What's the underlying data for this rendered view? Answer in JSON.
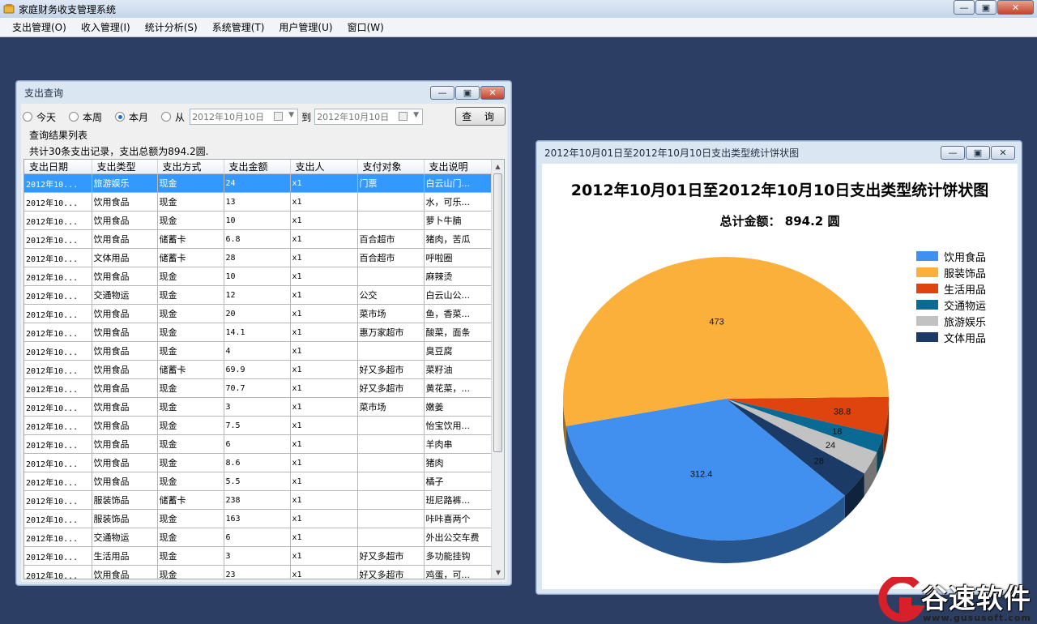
{
  "app": {
    "title": "家庭财务收支管理系统"
  },
  "menu": [
    "支出管理(O)",
    "收入管理(I)",
    "统计分析(S)",
    "系统管理(T)",
    "用户管理(U)",
    "窗口(W)"
  ],
  "query_window": {
    "title": "支出查询",
    "radios": [
      {
        "label": "今天",
        "checked": false
      },
      {
        "label": "本周",
        "checked": false
      },
      {
        "label": "本月",
        "checked": true
      },
      {
        "label": "从",
        "checked": false
      }
    ],
    "date_from": "2012年10月10日",
    "to_label": "到",
    "date_to": "2012年10月10日",
    "query_button": "查 询",
    "group_label": "查询结果列表",
    "summary": "共计30条支出记录，支出总额为894.2圆.",
    "columns": [
      "支出日期",
      "支出类型",
      "支出方式",
      "支出金额",
      "支出人",
      "支付对象",
      "支出说明"
    ],
    "rows": [
      [
        "2012年10...",
        "旅游娱乐",
        "现金",
        "24",
        "x1",
        "门票",
        "白云山门..."
      ],
      [
        "2012年10...",
        "饮用食品",
        "现金",
        "13",
        "x1",
        "",
        "水，可乐..."
      ],
      [
        "2012年10...",
        "饮用食品",
        "现金",
        "10",
        "x1",
        "",
        "萝卜牛腩"
      ],
      [
        "2012年10...",
        "饮用食品",
        "储蓄卡",
        "6.8",
        "x1",
        "百合超市",
        "猪肉，苦瓜"
      ],
      [
        "2012年10...",
        "文体用品",
        "储蓄卡",
        "28",
        "x1",
        "百合超市",
        "呼啦圈"
      ],
      [
        "2012年10...",
        "饮用食品",
        "现金",
        "10",
        "x1",
        "",
        "麻辣烫"
      ],
      [
        "2012年10...",
        "交通物运",
        "现金",
        "12",
        "x1",
        "公交",
        "白云山公..."
      ],
      [
        "2012年10...",
        "饮用食品",
        "现金",
        "20",
        "x1",
        "菜市场",
        "鱼，香菜..."
      ],
      [
        "2012年10...",
        "饮用食品",
        "现金",
        "14.1",
        "x1",
        "惠万家超市",
        "酸菜，面条"
      ],
      [
        "2012年10...",
        "饮用食品",
        "现金",
        "4",
        "x1",
        "",
        "臭豆腐"
      ],
      [
        "2012年10...",
        "饮用食品",
        "储蓄卡",
        "69.9",
        "x1",
        "好又多超市",
        "菜籽油"
      ],
      [
        "2012年10...",
        "饮用食品",
        "现金",
        "70.7",
        "x1",
        "好又多超市",
        "黄花菜，..."
      ],
      [
        "2012年10...",
        "饮用食品",
        "现金",
        "3",
        "x1",
        "菜市场",
        "嫩姜"
      ],
      [
        "2012年10...",
        "饮用食品",
        "现金",
        "7.5",
        "x1",
        "",
        "怡宝饮用..."
      ],
      [
        "2012年10...",
        "饮用食品",
        "现金",
        "6",
        "x1",
        "",
        "羊肉串"
      ],
      [
        "2012年10...",
        "饮用食品",
        "现金",
        "8.6",
        "x1",
        "",
        "猪肉"
      ],
      [
        "2012年10...",
        "饮用食品",
        "现金",
        "5.5",
        "x1",
        "",
        "橘子"
      ],
      [
        "2012年10...",
        "服装饰品",
        "储蓄卡",
        "238",
        "x1",
        "",
        "班尼路裤..."
      ],
      [
        "2012年10...",
        "服装饰品",
        "现金",
        "163",
        "x1",
        "",
        "咔咔喜两个"
      ],
      [
        "2012年10...",
        "交通物运",
        "现金",
        "6",
        "x1",
        "",
        "外出公交车费"
      ],
      [
        "2012年10...",
        "生活用品",
        "现金",
        "3",
        "x1",
        "好又多超市",
        "多功能挂钩"
      ],
      [
        "2012年10...",
        "饮用食品",
        "现金",
        "23",
        "x1",
        "好又多超市",
        "鸡蛋，可..."
      ]
    ]
  },
  "chart_window": {
    "title": "2012年10月01日至2012年10月10日支出类型统计饼状图",
    "subtitle": "总计金额： 894.2 圆"
  },
  "chart_data": {
    "type": "pie",
    "title": "2012年10月01日至2012年10月10日支出类型统计饼状图",
    "subtitle": "总计金额： 894.2 圆",
    "legend_position": "right",
    "categories": [
      "饮用食品",
      "服装饰品",
      "生活用品",
      "交通物运",
      "旅游娱乐",
      "文体用品"
    ],
    "values": [
      312.4,
      473,
      38.8,
      18,
      24,
      28
    ],
    "colors": [
      "#418fee",
      "#fbb03b",
      "#e0440e",
      "#0b6a93",
      "#c2c2c2",
      "#1b3a66"
    ]
  },
  "watermark": {
    "text": "谷速软件",
    "url": "www.gususoft.com"
  }
}
